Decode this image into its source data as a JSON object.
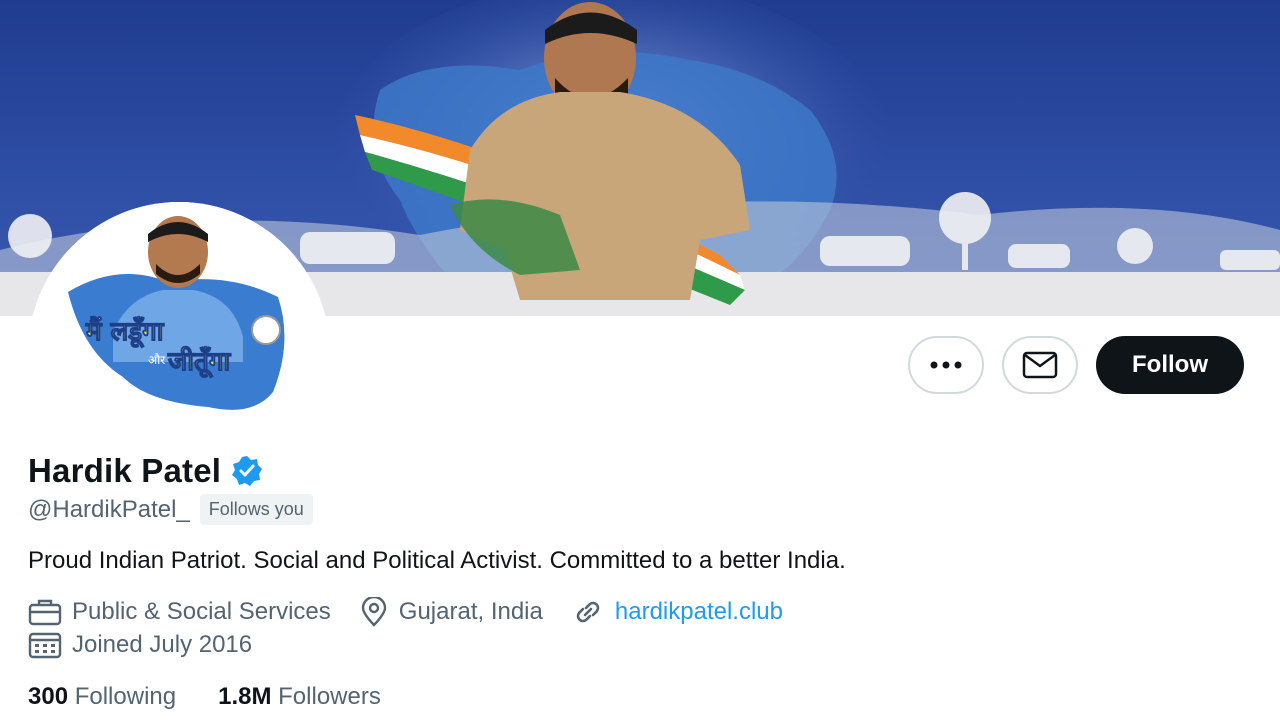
{
  "profile": {
    "name": "Hardik Patel",
    "handle": "@HardikPatel_",
    "follows_badge": "Follows you",
    "bio": "Proud Indian Patriot. Social and Political Activist. Committed to a better India.",
    "category": "Public & Social Services",
    "location": "Gujarat, India",
    "website": "hardikpatel.club",
    "joined": "Joined July 2016",
    "verified": true
  },
  "avatar": {
    "text_line1": "मैं लडूँगा",
    "text_line2": "और",
    "text_line3": "जीतूँगा"
  },
  "actions": {
    "follow_label": "Follow",
    "more_icon": "more-horizontal-icon",
    "message_icon": "envelope-icon"
  },
  "stats": {
    "following_count": "300",
    "following_label": "Following",
    "followers_count": "1.8M",
    "followers_label": "Followers"
  },
  "colors": {
    "banner_blue": "#2a4aa0",
    "accent": "#1d9bf0",
    "follow_bg": "#0f1419"
  }
}
